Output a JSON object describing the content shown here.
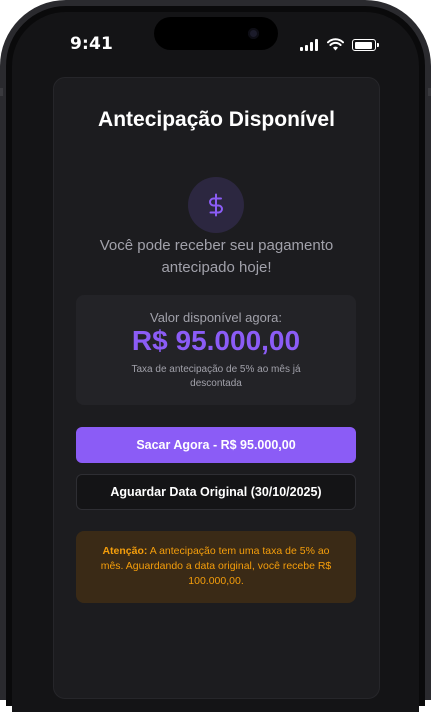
{
  "status_bar": {
    "time": "9:41",
    "icons": [
      "signal-icon",
      "wifi-icon",
      "battery-icon"
    ]
  },
  "card": {
    "title": "Antecipação Disponível",
    "icon": "dollar-icon",
    "subtitle": "Você pode receber seu pagamento antecipado hoje!",
    "value_box": {
      "label": "Valor disponível agora:",
      "amount": "R$ 95.000,00",
      "note": "Taxa de antecipação de 5% ao mês já descontada"
    },
    "primary_button": "Sacar Agora - R$ 95.000,00",
    "secondary_button": "Aguardar Data Original (30/10/2025)",
    "warning": {
      "label": "Atenção:",
      "text": " A antecipação tem uma taxa de 5% ao mês. Aguardando a data original, você recebe R$ 100.000,00."
    }
  },
  "colors": {
    "accent": "#8b5cf6",
    "warning": "#f59e0b",
    "background": "#141416",
    "card": "#1c1c1f"
  }
}
